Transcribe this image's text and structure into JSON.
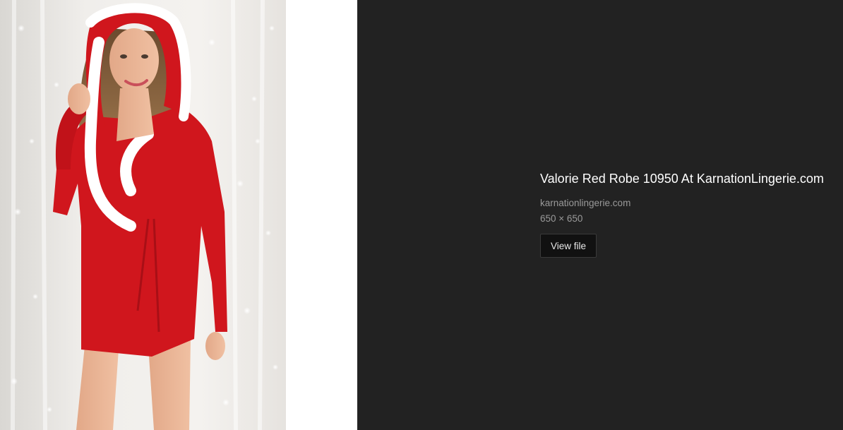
{
  "preview": {
    "image_alt": "Valorie Red Robe 10950 At KarnationLingerie.com"
  },
  "info": {
    "title": "Valorie Red Robe 10950 At KarnationLingerie.com",
    "source_domain": "karnationlingerie.com",
    "dimensions": "650 × 650",
    "view_file_label": "View file"
  },
  "colors": {
    "panel_background": "#222222",
    "title_text": "#ffffff",
    "meta_text": "#9a9a9a",
    "robe_red": "#d0161d"
  }
}
